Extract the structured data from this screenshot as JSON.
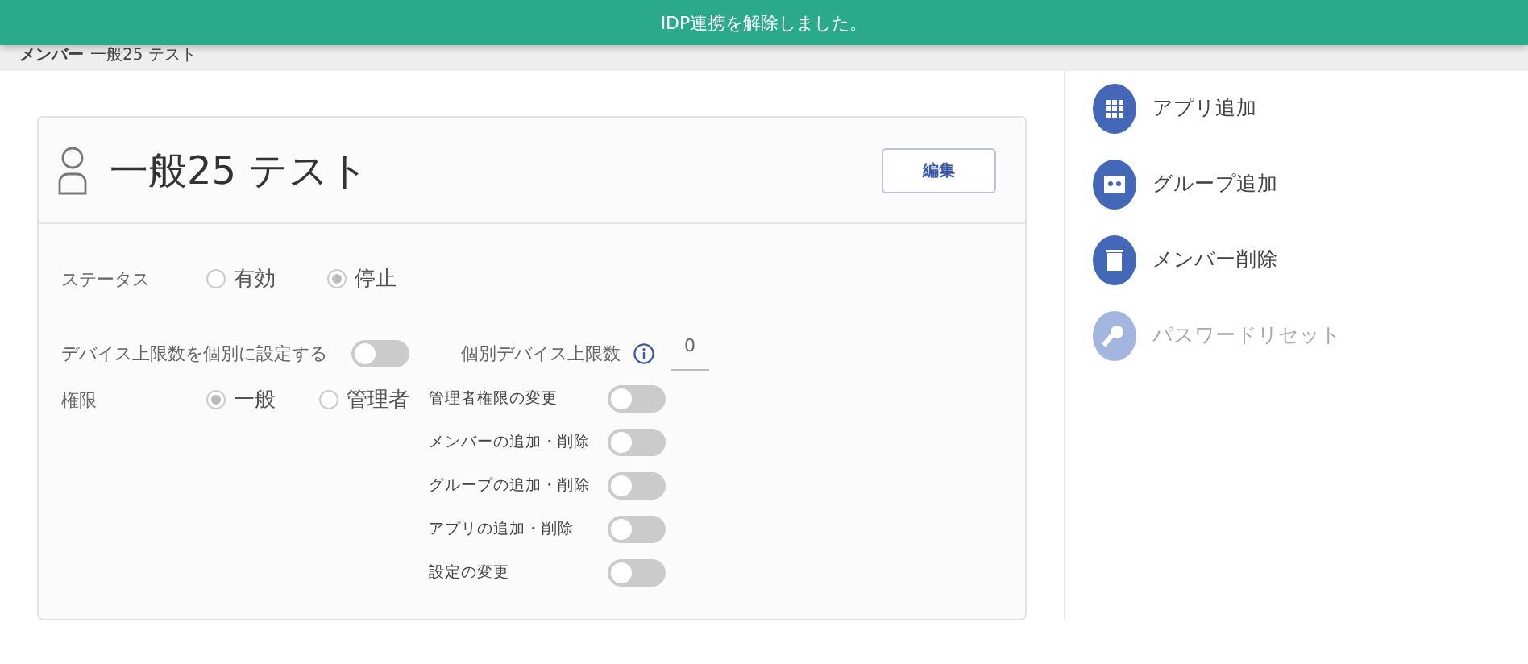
{
  "toast": {
    "message": "IDP連携を解除しました。"
  },
  "breadcrumb": [
    "メンバー",
    "一般25 テスト"
  ],
  "member": {
    "name": "一般25 テスト",
    "edit_button": "編集"
  },
  "status": {
    "label": "ステータス",
    "options": [
      {
        "label": "有効",
        "selected": false
      },
      {
        "label": "停止",
        "selected": true
      }
    ]
  },
  "device_limit": {
    "label": "デバイス上限数を個別に設定する",
    "on": false,
    "limit_label": "個別デバイス上限数",
    "limit_value": "0"
  },
  "role": {
    "label": "権限",
    "options": [
      {
        "label": "一般",
        "selected": true
      },
      {
        "label": "管理者",
        "selected": false
      }
    ]
  },
  "permissions": [
    {
      "label": "管理者権限の変更",
      "on": false
    },
    {
      "label": "メンバーの追加・削除",
      "on": false
    },
    {
      "label": "グループの追加・削除",
      "on": false
    },
    {
      "label": "アプリの追加・削除",
      "on": false
    },
    {
      "label": "設定の変更",
      "on": false
    }
  ],
  "actions": [
    {
      "kind": "apps",
      "label": "アプリ追加",
      "disabled": false
    },
    {
      "kind": "group",
      "label": "グループ追加",
      "disabled": false
    },
    {
      "kind": "trash",
      "label": "メンバー削除",
      "disabled": false
    },
    {
      "kind": "key",
      "label": "パスワードリセット",
      "disabled": true
    }
  ]
}
